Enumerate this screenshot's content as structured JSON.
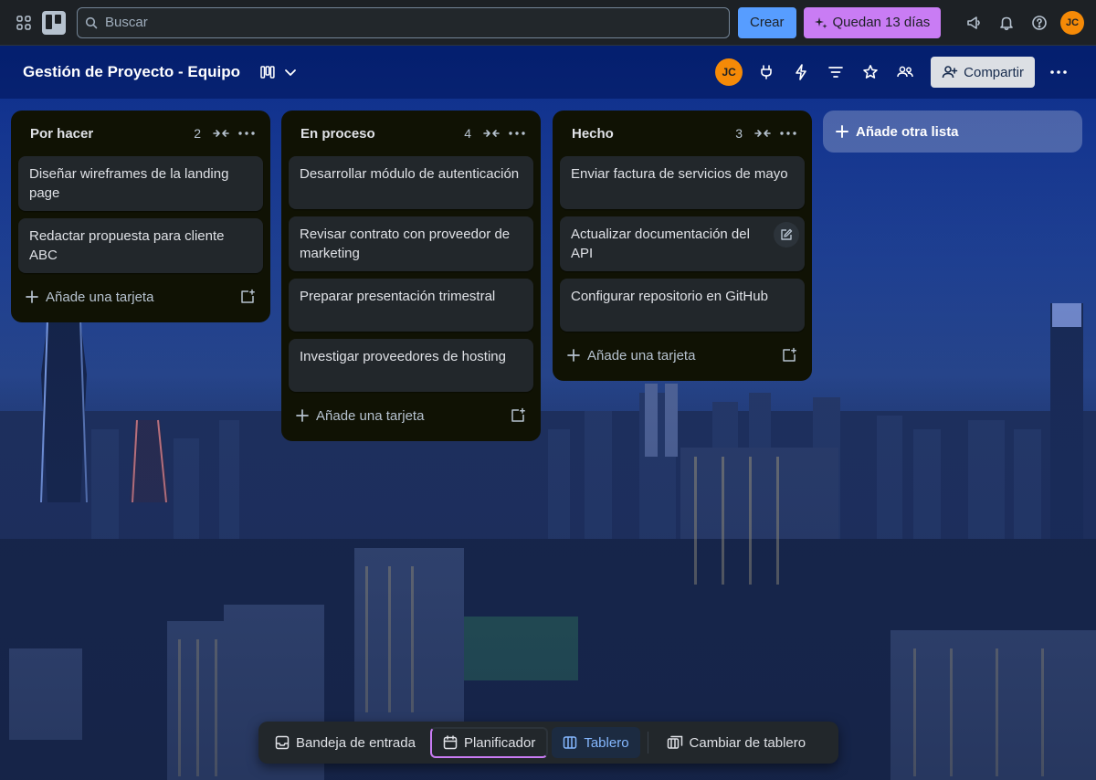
{
  "topbar": {
    "search_placeholder": "Buscar",
    "create_label": "Crear",
    "trial_label": "Quedan 13 días",
    "avatar_initials": "JC"
  },
  "board": {
    "title": "Gestión de Proyecto - Equipo",
    "member_initials": "JC",
    "share_label": "Compartir"
  },
  "lists": [
    {
      "title": "Por hacer",
      "count": "2",
      "cards": [
        "Diseñar wireframes de la landing page",
        "Redactar propuesta para cliente ABC"
      ],
      "add_label": "Añade una tarjeta"
    },
    {
      "title": "En proceso",
      "count": "4",
      "cards": [
        "Desarrollar módulo de autenticación",
        "Revisar contrato con proveedor de marketing",
        "Preparar presentación trimestral",
        "Investigar proveedores de hosting"
      ],
      "add_label": "Añade una tarjeta"
    },
    {
      "title": "Hecho",
      "count": "3",
      "cards": [
        "Enviar factura de servicios de mayo",
        "Actualizar documentación del API",
        "Configurar repositorio en GitHub"
      ],
      "add_label": "Añade una tarjeta"
    }
  ],
  "add_list_label": "Añade otra lista",
  "switcher": {
    "inbox": "Bandeja de entrada",
    "planner": "Planificador",
    "board": "Tablero",
    "switch": "Cambiar de tablero"
  },
  "colors": {
    "accent": "#579dff",
    "trial": "#c97cf4",
    "avatar": "#f58a07"
  }
}
